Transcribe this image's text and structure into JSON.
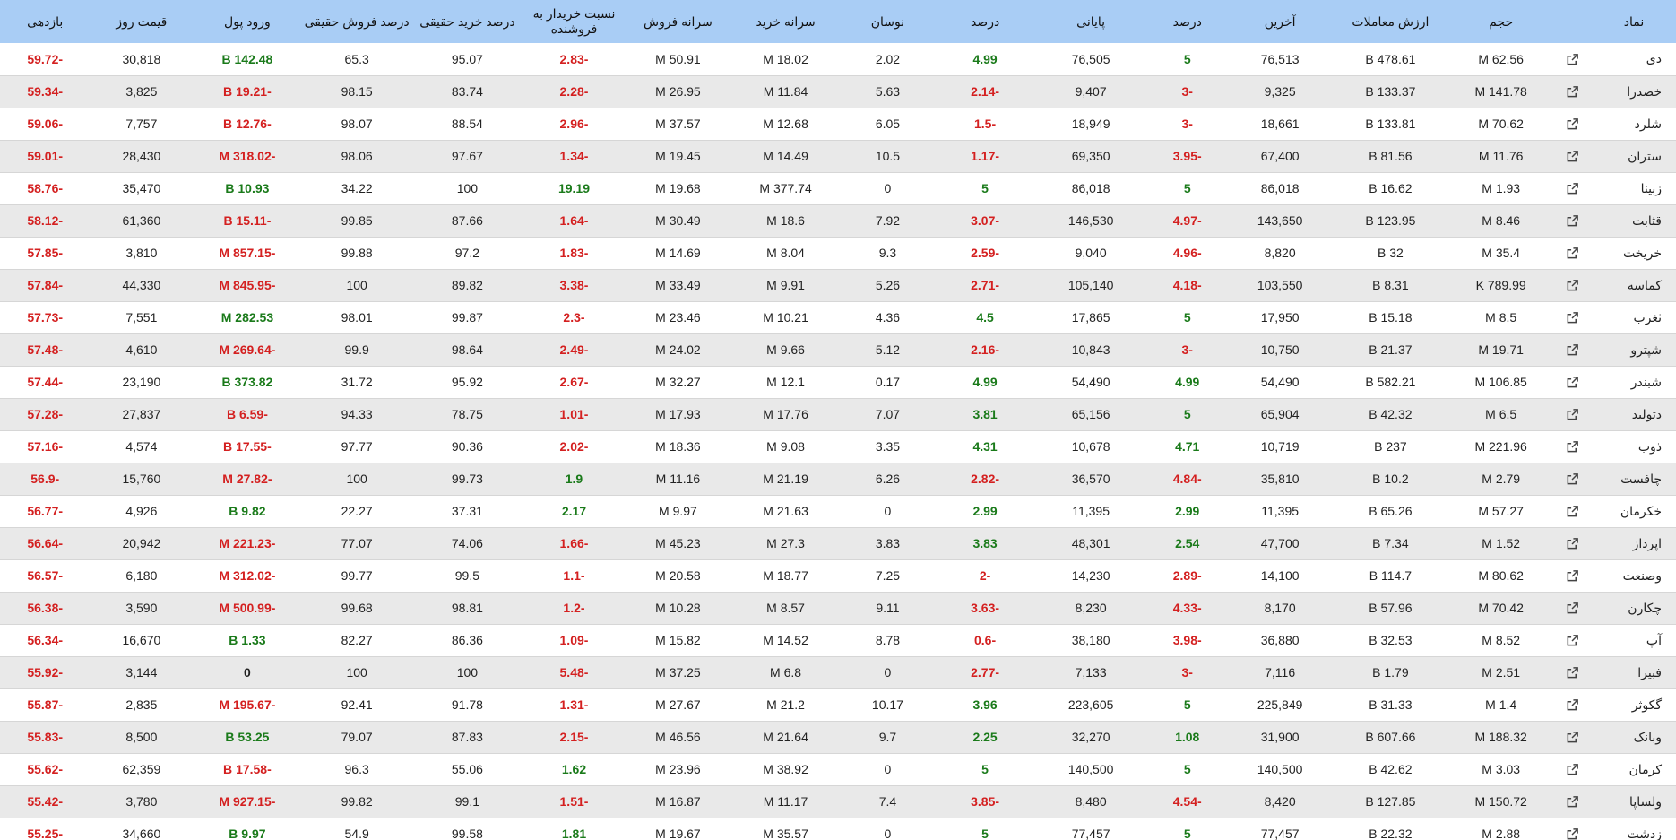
{
  "columns": [
    "نماد",
    "",
    "حجم",
    "ارزش معاملات",
    "آخرین",
    "درصد",
    "پایانی",
    "درصد",
    "نوسان",
    "سرانه خرید",
    "سرانه فروش",
    "نسبت خریدار به فروشنده",
    "درصد خرید حقیقی",
    "درصد فروش حقیقی",
    "ورود پول",
    "قیمت روز",
    "بازدهی"
  ],
  "link_icon": "external-link-icon",
  "colors": {
    "header_bg": "#a9cdf5",
    "positive": "#1a7a1a",
    "negative": "#d42020",
    "stripe": "#e9e9e9"
  },
  "rows": [
    [
      "دی",
      "62.56 M",
      "478.61 B",
      "76,513",
      "5",
      "76,505",
      "4.99",
      "2.02",
      "18.02 M",
      "50.91 M",
      "-2.83",
      "95.07",
      "65.3",
      "142.48 B",
      "30,818",
      "-59.72"
    ],
    [
      "خصدرا",
      "141.78 M",
      "133.37 B",
      "9,325",
      "-3",
      "9,407",
      "-2.14",
      "5.63",
      "11.84 M",
      "26.95 M",
      "-2.28",
      "83.74",
      "98.15",
      "-19.21 B",
      "3,825",
      "-59.34"
    ],
    [
      "شلرد",
      "70.62 M",
      "133.81 B",
      "18,661",
      "-3",
      "18,949",
      "-1.5",
      "6.05",
      "12.68 M",
      "37.57 M",
      "-2.96",
      "88.54",
      "98.07",
      "-12.76 B",
      "7,757",
      "-59.06"
    ],
    [
      "ستران",
      "11.76 M",
      "81.56 B",
      "67,400",
      "-3.95",
      "69,350",
      "-1.17",
      "10.5",
      "14.49 M",
      "19.45 M",
      "-1.34",
      "97.67",
      "98.06",
      "-318.02 M",
      "28,430",
      "-59.01"
    ],
    [
      "زبینا",
      "1.93 M",
      "16.62 B",
      "86,018",
      "5",
      "86,018",
      "5",
      "0",
      "377.74 M",
      "19.68 M",
      "19.19",
      "100",
      "34.22",
      "10.93 B",
      "35,470",
      "-58.76"
    ],
    [
      "قثابت",
      "8.46 M",
      "123.95 B",
      "143,650",
      "-4.97",
      "146,530",
      "-3.07",
      "7.92",
      "18.6 M",
      "30.49 M",
      "-1.64",
      "87.66",
      "99.85",
      "-15.11 B",
      "61,360",
      "-58.12"
    ],
    [
      "خریخت",
      "35.4 M",
      "32 B",
      "8,820",
      "-4.96",
      "9,040",
      "-2.59",
      "9.3",
      "8.04 M",
      "14.69 M",
      "-1.83",
      "97.2",
      "99.88",
      "-857.15 M",
      "3,810",
      "-57.85"
    ],
    [
      "کماسه",
      "789.99 K",
      "8.31 B",
      "103,550",
      "-4.18",
      "105,140",
      "-2.71",
      "5.26",
      "9.91 M",
      "33.49 M",
      "-3.38",
      "89.82",
      "100",
      "-845.95 M",
      "44,330",
      "-57.84"
    ],
    [
      "ثغرب",
      "8.5 M",
      "15.18 B",
      "17,950",
      "5",
      "17,865",
      "4.5",
      "4.36",
      "10.21 M",
      "23.46 M",
      "-2.3",
      "99.87",
      "98.01",
      "282.53 M",
      "7,551",
      "-57.73"
    ],
    [
      "شپترو",
      "19.71 M",
      "21.37 B",
      "10,750",
      "-3",
      "10,843",
      "-2.16",
      "5.12",
      "9.66 M",
      "24.02 M",
      "-2.49",
      "98.64",
      "99.9",
      "-269.64 M",
      "4,610",
      "-57.48"
    ],
    [
      "شبندر",
      "106.85 M",
      "582.21 B",
      "54,490",
      "4.99",
      "54,490",
      "4.99",
      "0.17",
      "12.1 M",
      "32.27 M",
      "-2.67",
      "95.92",
      "31.72",
      "373.82 B",
      "23,190",
      "-57.44"
    ],
    [
      "دتولید",
      "6.5 M",
      "42.32 B",
      "65,904",
      "5",
      "65,156",
      "3.81",
      "7.07",
      "17.76 M",
      "17.93 M",
      "-1.01",
      "78.75",
      "94.33",
      "-6.59 B",
      "27,837",
      "-57.28"
    ],
    [
      "ذوب",
      "221.96 M",
      "237 B",
      "10,719",
      "4.71",
      "10,678",
      "4.31",
      "3.35",
      "9.08 M",
      "18.36 M",
      "-2.02",
      "90.36",
      "97.77",
      "-17.55 B",
      "4,574",
      "-57.16"
    ],
    [
      "چافست",
      "2.79 M",
      "10.2 B",
      "35,810",
      "-4.84",
      "36,570",
      "-2.82",
      "6.26",
      "21.19 M",
      "11.16 M",
      "1.9",
      "99.73",
      "100",
      "-27.82 M",
      "15,760",
      "-56.9"
    ],
    [
      "خکرمان",
      "57.27 M",
      "65.26 B",
      "11,395",
      "2.99",
      "11,395",
      "2.99",
      "0",
      "21.63 M",
      "9.97 M",
      "2.17",
      "37.31",
      "22.27",
      "9.82 B",
      "4,926",
      "-56.77"
    ],
    [
      "اپرداز",
      "1.52 M",
      "7.34 B",
      "47,700",
      "2.54",
      "48,301",
      "3.83",
      "3.83",
      "27.3 M",
      "45.23 M",
      "-1.66",
      "74.06",
      "77.07",
      "-221.23 M",
      "20,942",
      "-56.64"
    ],
    [
      "وصنعت",
      "80.62 M",
      "114.7 B",
      "14,100",
      "-2.89",
      "14,230",
      "-2",
      "7.25",
      "18.77 M",
      "20.58 M",
      "-1.1",
      "99.5",
      "99.77",
      "-312.02 M",
      "6,180",
      "-56.57"
    ],
    [
      "چکارن",
      "70.42 M",
      "57.96 B",
      "8,170",
      "-4.33",
      "8,230",
      "-3.63",
      "9.11",
      "8.57 M",
      "10.28 M",
      "-1.2",
      "98.81",
      "99.68",
      "-500.99 M",
      "3,590",
      "-56.38"
    ],
    [
      "آپ",
      "8.52 M",
      "32.53 B",
      "36,880",
      "-3.98",
      "38,180",
      "-0.6",
      "8.78",
      "14.52 M",
      "15.82 M",
      "-1.09",
      "86.36",
      "82.27",
      "1.33 B",
      "16,670",
      "-56.34"
    ],
    [
      "فبیرا",
      "2.51 M",
      "1.79 B",
      "7,116",
      "-3",
      "7,133",
      "-2.77",
      "0",
      "6.8 M",
      "37.25 M",
      "-5.48",
      "100",
      "100",
      "0",
      "3,144",
      "-55.92"
    ],
    [
      "گکوثر",
      "1.4 M",
      "31.33 B",
      "225,849",
      "5",
      "223,605",
      "3.96",
      "10.17",
      "21.2 M",
      "27.67 M",
      "-1.31",
      "91.78",
      "92.41",
      "-195.67 M",
      "2,835",
      "-55.87"
    ],
    [
      "وبانک",
      "188.32 M",
      "607.66 B",
      "31,900",
      "1.08",
      "32,270",
      "2.25",
      "9.7",
      "21.64 M",
      "46.56 M",
      "-2.15",
      "87.83",
      "79.07",
      "53.25 B",
      "8,500",
      "-55.83"
    ],
    [
      "کرمان",
      "3.03 M",
      "42.62 B",
      "140,500",
      "5",
      "140,500",
      "5",
      "0",
      "38.92 M",
      "23.96 M",
      "1.62",
      "55.06",
      "96.3",
      "-17.58 B",
      "62,359",
      "-55.62"
    ],
    [
      "ولساپا",
      "150.72 M",
      "127.85 B",
      "8,420",
      "-4.54",
      "8,480",
      "-3.85",
      "7.4",
      "11.17 M",
      "16.87 M",
      "-1.51",
      "99.1",
      "99.82",
      "-927.15 M",
      "3,780",
      "-55.42"
    ],
    [
      "زدشت",
      "2.88 M",
      "22.32 B",
      "77,457",
      "5",
      "77,457",
      "5",
      "0",
      "35.57 M",
      "19.67 M",
      "1.81",
      "99.58",
      "54.9",
      "9.97 B",
      "34,660",
      "-55.25"
    ]
  ]
}
